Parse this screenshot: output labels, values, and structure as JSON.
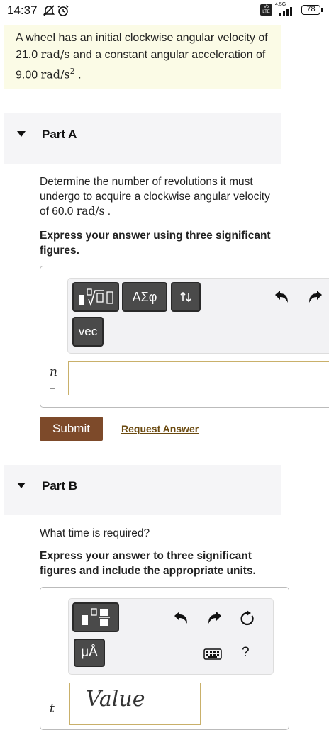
{
  "status_bar": {
    "time": "14:37",
    "network": "4.5G",
    "volte": "Vo LTE",
    "battery": "78"
  },
  "problem": {
    "text_1": "A wheel has an initial clockwise angular velocity of 21.0 ",
    "unit_1": "rad/s",
    "text_2": " and a constant angular acceleration of 9.00 ",
    "unit_2": "rad/s",
    "exp_2": "2",
    "text_3": " ."
  },
  "part_a": {
    "title": "Part A",
    "question_1": "Determine the number of revolutions it must undergo to acquire a clockwise angular velocity of 60.0 ",
    "question_unit": "rad/s",
    "question_2": " .",
    "instruction": "Express your answer using three significant figures.",
    "tool_greek": "ΑΣφ",
    "tool_vec": "vec",
    "var_label": "n",
    "equals": "=",
    "submit_label": "Submit",
    "request_label": "Request Answer"
  },
  "part_b": {
    "title": "Part B",
    "question": "What time is required?",
    "instruction": "Express your answer to three significant figures and include the appropriate units.",
    "tool_units": "μÅ",
    "help_label": "?",
    "value_placeholder": "Value",
    "var_label": "t"
  }
}
